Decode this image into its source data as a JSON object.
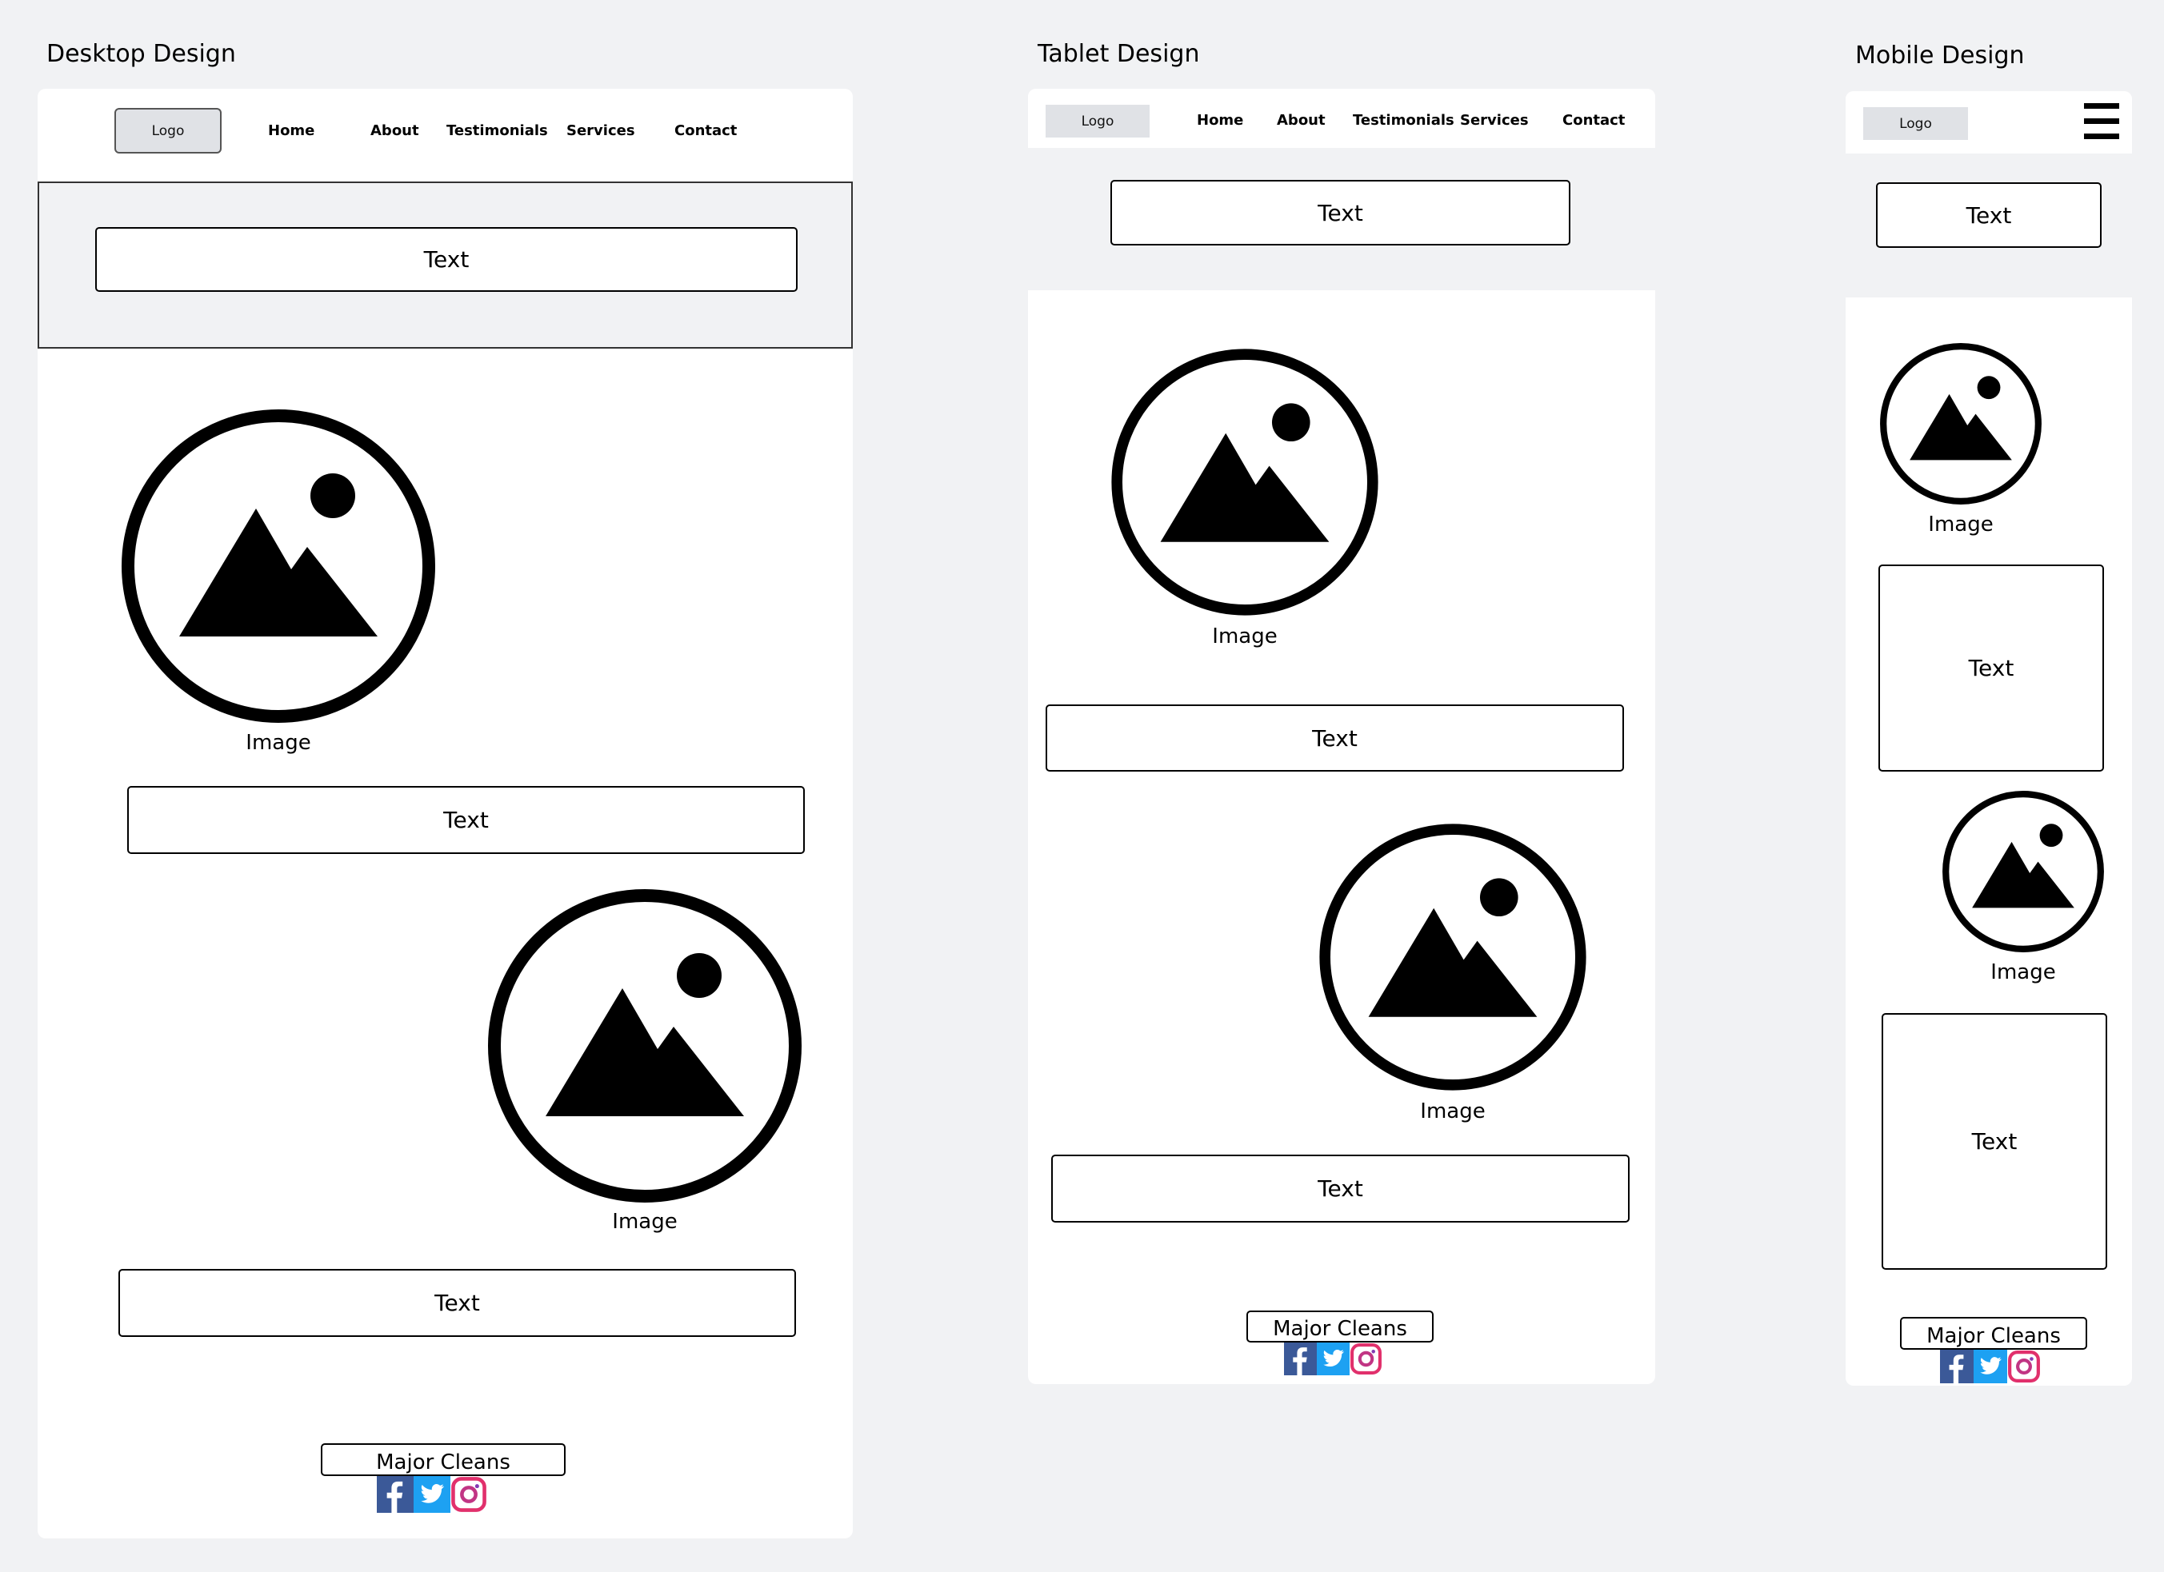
{
  "frames": {
    "desktop": {
      "title": "Desktop Design",
      "logo": "Logo",
      "nav": [
        "Home",
        "About",
        "Testimonials",
        "Services",
        "Contact"
      ],
      "hero_text": "Text",
      "sections": [
        {
          "image_label": "Image",
          "text": "Text"
        },
        {
          "image_label": "Image",
          "text": "Text"
        }
      ],
      "footer_brand": "Major Cleans"
    },
    "tablet": {
      "title": "Tablet Design",
      "logo": "Logo",
      "nav": [
        "Home",
        "About",
        "Testimonials",
        "Services",
        "Contact"
      ],
      "hero_text": "Text",
      "sections": [
        {
          "image_label": "Image",
          "text": "Text"
        },
        {
          "image_label": "Image",
          "text": "Text"
        }
      ],
      "footer_brand": "Major Cleans"
    },
    "mobile": {
      "title": "Mobile Design",
      "logo": "Logo",
      "menu_icon": "hamburger-menu-icon",
      "hero_text": "Text",
      "sections": [
        {
          "image_label": "Image",
          "text": "Text"
        },
        {
          "image_label": "Image",
          "text": "Text"
        }
      ],
      "footer_brand": "Major Cleans"
    }
  },
  "social_icons": [
    "facebook-icon",
    "twitter-icon",
    "instagram-icon"
  ],
  "colors": {
    "canvas": "#f1f2f4",
    "frame": "#ffffff",
    "logo_fill": "#e0e2e6",
    "facebook": "#3b5998",
    "twitter": "#1da1f2",
    "instagram": "#e1306c"
  }
}
